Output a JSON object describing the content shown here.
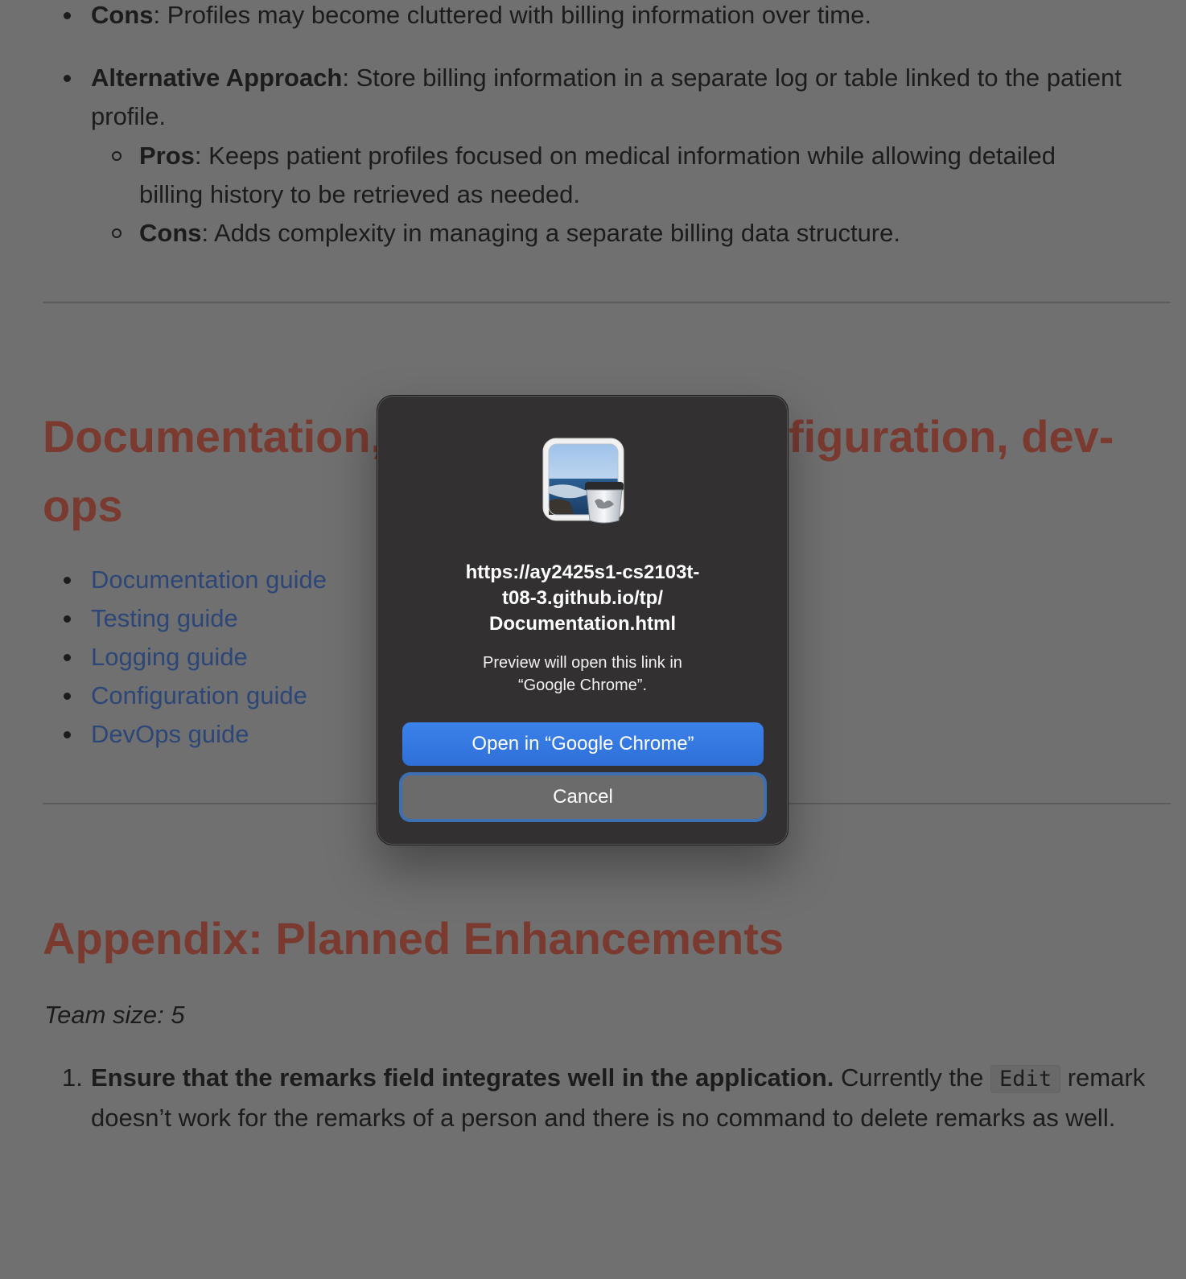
{
  "top_list": {
    "cons_1": {
      "label": "Cons",
      "text": ": Profiles may become cluttered with billing information over time."
    },
    "alt": {
      "label": "Alternative Approach",
      "text": ": Store billing information in a separate log or table linked to the patient",
      "text_line2": "profile."
    },
    "pros": {
      "label": "Pros",
      "text": ": Keeps patient profiles focused on medical information while allowing detailed",
      "text_line2": "billing history to be retrieved as needed."
    },
    "cons_2": {
      "label": "Cons",
      "text": ": Adds complexity in managing a separate billing data structure."
    }
  },
  "section1": {
    "heading_left": "Documentation,",
    "heading_right": "figuration, dev-",
    "heading_line2": "ops",
    "links": [
      "Documentation guide",
      "Testing guide",
      "Logging guide",
      "Configuration guide",
      "DevOps guide"
    ]
  },
  "section2": {
    "heading": "Appendix: Planned Enhancements",
    "team": "Team size: 5",
    "items": [
      {
        "number": "1.",
        "bold": "Ensure that the remarks field integrates well in the application.",
        "text_a": " Currently the ",
        "code": "Edit",
        "text_b": " remark",
        "line2": "doesn’t work for the remarks of a person and there is no command to delete remarks as well."
      }
    ]
  },
  "dialog": {
    "icon": "preview-app-icon",
    "url_line1": "https://ay2425s1-cs2103t-",
    "url_line2": "t08-3.github.io/tp/",
    "url_line3": "Documentation.html",
    "message_line1": "Preview will open this link in",
    "message_line2": "“Google Chrome”.",
    "open_label": "Open in “Google Chrome”",
    "cancel_label": "Cancel"
  },
  "colors": {
    "overlay_bg": "#707070",
    "heading": "#7a3a30",
    "link": "#2c4677",
    "dialog_bg": "#323030",
    "primary_button": "#2f6fd8"
  }
}
